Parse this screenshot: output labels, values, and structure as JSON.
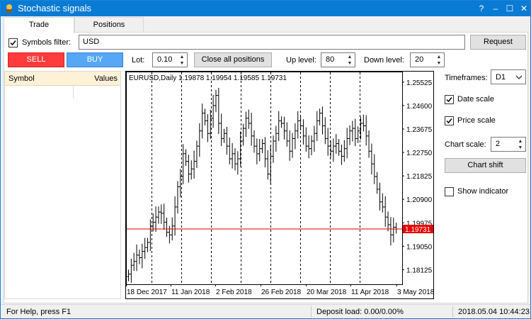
{
  "window": {
    "title": "Stochastic signals",
    "controls": [
      "?",
      "–",
      "☐",
      "✕"
    ]
  },
  "tabs": [
    {
      "label": "Trade",
      "active": true
    },
    {
      "label": "Positions",
      "active": false
    }
  ],
  "filter": {
    "label": "Symbols filter:",
    "checked": true,
    "value": "USD",
    "request_label": "Request"
  },
  "trade": {
    "sell_label": "SELL",
    "buy_label": "BUY",
    "lot_label": "Lot:",
    "lot_value": "0.10",
    "close_all_label": "Close all positions",
    "up_level_label": "Up level:",
    "up_level_value": "80",
    "down_level_label": "Down level:",
    "down_level_value": "20"
  },
  "symbols_table": {
    "columns": [
      "Symbol",
      "Values"
    ],
    "rows": []
  },
  "side": {
    "timeframes_label": "Timeframes:",
    "timeframe_value": "D1",
    "date_scale_label": "Date scale",
    "date_scale_checked": true,
    "price_scale_label": "Price scale",
    "price_scale_checked": true,
    "chart_scale_label": "Chart scale:",
    "chart_scale_value": "2",
    "chart_shift_label": "Chart shift",
    "show_indicator_label": "Show indicator",
    "show_indicator_checked": false
  },
  "chart_data": {
    "type": "bar",
    "symbol_header": "EURUSD,Daily  1.19878 1.19954 1.19585 1.19731",
    "price_ticks": [
      "1.25525",
      "1.24600",
      "1.23675",
      "1.22750",
      "1.21825",
      "1.20900",
      "1.19975",
      "1.19050",
      "1.18125"
    ],
    "price_tick_values": [
      1.25525,
      1.246,
      1.23675,
      1.2275,
      1.21825,
      1.209,
      1.19975,
      1.1905,
      1.18125
    ],
    "ylim": [
      1.1755,
      1.2594
    ],
    "current_price": "1.19731",
    "current_price_value": 1.19731,
    "date_ticks": [
      "18 Dec 2017",
      "11 Jan 2018",
      "2 Feb 2018",
      "26 Feb 2018",
      "20 Mar 2018",
      "11 Apr 2018",
      "3 May 2018"
    ],
    "period_separators": 8,
    "closes": [
      1.1795,
      1.183,
      1.1845,
      1.187,
      1.186,
      1.1885,
      1.19,
      1.192,
      1.1985,
      1.2,
      1.202,
      1.204,
      1.2035,
      1.2,
      1.196,
      1.195,
      1.1985,
      1.206,
      1.214,
      1.218,
      1.227,
      1.224,
      1.219,
      1.221,
      1.224,
      1.23,
      1.236,
      1.243,
      1.24,
      1.235,
      1.241,
      1.246,
      1.25,
      1.239,
      1.233,
      1.235,
      1.23,
      1.225,
      1.227,
      1.223,
      1.225,
      1.232,
      1.237,
      1.241,
      1.239,
      1.234,
      1.23,
      1.227,
      1.229,
      1.231,
      1.225,
      1.219,
      1.226,
      1.232,
      1.235,
      1.24,
      1.239,
      1.236,
      1.232,
      1.228,
      1.233,
      1.236,
      1.24,
      1.238,
      1.234,
      1.23,
      1.229,
      1.232,
      1.235,
      1.24,
      1.243,
      1.238,
      1.233,
      1.23,
      1.228,
      1.23,
      1.231,
      1.228,
      1.226,
      1.229,
      1.233,
      1.236,
      1.237,
      1.233,
      1.236,
      1.239,
      1.238,
      1.234,
      1.228,
      1.223,
      1.218,
      1.213,
      1.208,
      1.206,
      1.202,
      1.199,
      1.195,
      1.198,
      1.1973
    ]
  },
  "status": {
    "help": "For Help, press F1",
    "deposit": "Deposit load: 0.00/0.00%",
    "datetime": "2018.05.04 10:44:23"
  }
}
